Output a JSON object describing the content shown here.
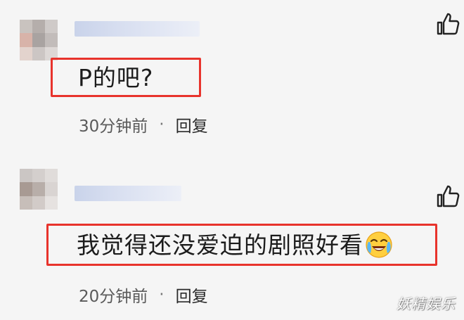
{
  "comments": [
    {
      "text": "P的吧?",
      "time": "30分钟前",
      "separator": "·",
      "reply_label": "回复",
      "has_emoji": false
    },
    {
      "text": "我觉得还没爱迫的剧照好看",
      "time": "20分钟前",
      "separator": "·",
      "reply_label": "回复",
      "has_emoji": true,
      "emoji_name": "crying-laughing-emoji"
    }
  ],
  "icons": {
    "like": "thumbs-up-icon"
  },
  "colors": {
    "highlight_border": "#e8332c",
    "background": "#f5f5f5",
    "meta_text": "#5a5a5a"
  },
  "watermark": "妖精娱乐"
}
